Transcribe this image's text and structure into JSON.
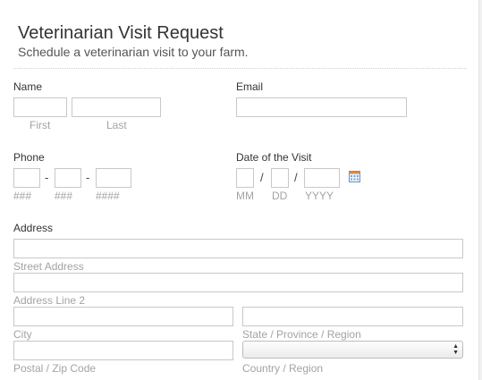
{
  "form": {
    "title": "Veterinarian Visit Request",
    "subtitle": "Schedule a veterinarian visit to your farm."
  },
  "name": {
    "label": "Name",
    "first": "First",
    "last": "Last",
    "first_value": "",
    "last_value": ""
  },
  "email": {
    "label": "Email",
    "value": ""
  },
  "phone": {
    "label": "Phone",
    "area": "###",
    "prefix": "###",
    "line": "####",
    "separator": "-"
  },
  "visit_date": {
    "label": "Date of the Visit",
    "mm": "MM",
    "dd": "DD",
    "yyyy": "YYYY",
    "separator": "/"
  },
  "address": {
    "label": "Address",
    "street": "Street Address",
    "line2": "Address Line 2",
    "city": "City",
    "state": "State / Province / Region",
    "postal": "Postal / Zip Code",
    "country": "Country / Region",
    "country_value": ""
  },
  "icons": {
    "calendar": "calendar-icon",
    "select_arrows": "updown-arrows-icon"
  }
}
